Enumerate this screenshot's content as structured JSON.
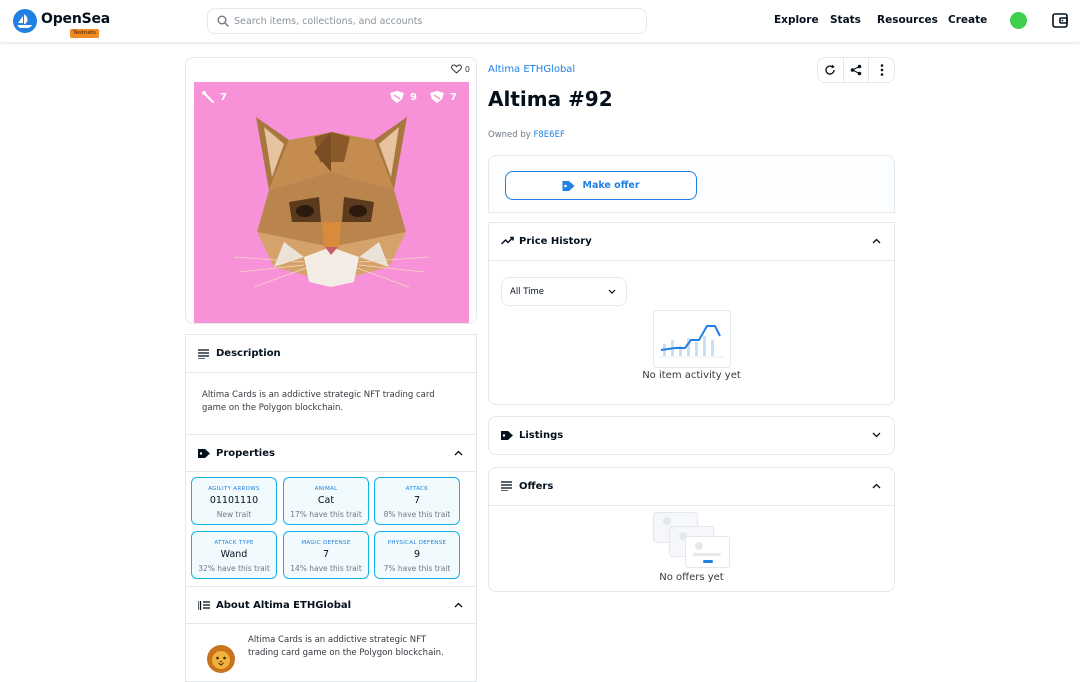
{
  "header": {
    "brand": "OpenSea",
    "badge": "Testnets",
    "search_placeholder": "Search items, collections, and accounts",
    "nav": [
      "Explore",
      "Stats",
      "Resources",
      "Create"
    ]
  },
  "item": {
    "favorites": "0",
    "overlay_left": "7",
    "overlay_mid": "9",
    "overlay_right": "7",
    "collection": "Altima ETHGlobal",
    "title": "Altima #92",
    "owned_prefix": "Owned by",
    "owner": "F8E6EF",
    "make_offer": "Make offer"
  },
  "description": {
    "title": "Description",
    "text": "Altima Cards is an addictive strategic NFT trading card game on the Polygon blockchain."
  },
  "properties": {
    "title": "Properties",
    "items": [
      {
        "type": "AGILITY ARROWS",
        "value": "01101110",
        "rarity": "New trait"
      },
      {
        "type": "ANIMAL",
        "value": "Cat",
        "rarity": "17% have this trait"
      },
      {
        "type": "ATTACK",
        "value": "7",
        "rarity": "8% have this trait"
      },
      {
        "type": "ATTACK TYPE",
        "value": "Wand",
        "rarity": "32% have this trait"
      },
      {
        "type": "MAGIC DEFENSE",
        "value": "7",
        "rarity": "14% have this trait"
      },
      {
        "type": "PHYSICAL DEFENSE",
        "value": "9",
        "rarity": "7% have this trait"
      }
    ]
  },
  "about": {
    "title": "About Altima ETHGlobal",
    "text": "Altima Cards is an addictive strategic NFT trading card game on the Polygon blockchain."
  },
  "price_history": {
    "title": "Price History",
    "range": "All Time",
    "empty": "No item activity yet"
  },
  "listings": {
    "title": "Listings"
  },
  "offers": {
    "title": "Offers",
    "empty": "No offers yet"
  },
  "colors": {
    "accent": "#2081e2",
    "nft_bg": "#f792d8",
    "status_dot": "#3fcf4f",
    "property_border": "#15b2e5"
  }
}
